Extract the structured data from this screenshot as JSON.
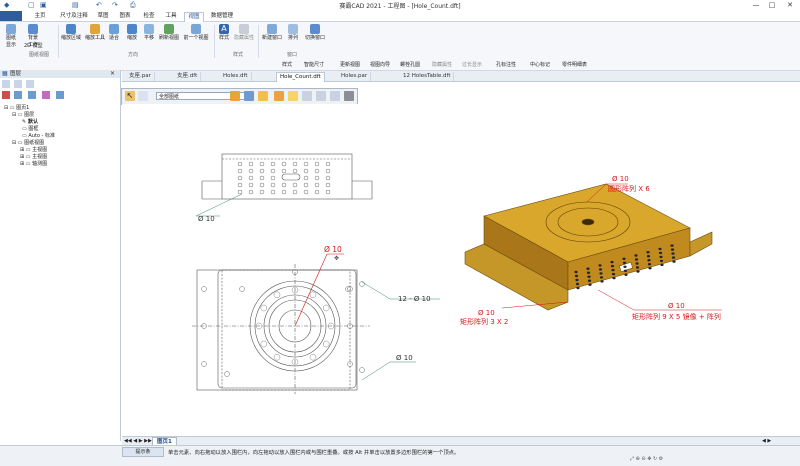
{
  "window": {
    "title": "赛霸CAD 2021 - 工程图 - [Hole_Count.dft]",
    "min_glyph": "—",
    "max_glyph": "□",
    "close_glyph": "✕"
  },
  "menu": {
    "app_button": "",
    "tabs": [
      "主页",
      "尺寸及注释",
      "草图",
      "图表",
      "检查",
      "工具",
      "视图",
      "数据管理"
    ],
    "active_tab": "视图"
  },
  "ribbon": {
    "buttons": [
      "图纸\n显示",
      "背景\n工作",
      "2D 模型",
      "缩放区域",
      "缩放工具",
      "适合",
      "缩放",
      "平移",
      "刷新视图",
      "前一个视图",
      "样式",
      "隐藏属性",
      "新建窗口",
      "排列",
      "切换窗口"
    ],
    "groups": [
      "图纸视图",
      "方向",
      "样式",
      "窗口"
    ]
  },
  "toolbar2": [
    "样式",
    "智能尺寸",
    "更新视图",
    "视图向导",
    "螺栓孔圆",
    "隐藏属性",
    "过长显示",
    "孔标注性",
    "中心标记",
    "零件明细表"
  ],
  "doc_tabs": [
    "支座.par",
    "支座.dft",
    "Holes.dft",
    "Hole_Count.dft",
    "Holes.par",
    "12 HolesTable.dft"
  ],
  "active_doc": "Hole_Count.dft",
  "left_panel": {
    "title": "图层",
    "tree": [
      "图页1",
      "图层",
      "默认",
      "图框",
      "Auto - 标准",
      "图纸视图",
      "主视图",
      "主视图",
      "轴测图"
    ]
  },
  "draw_toolbar": {
    "select_value": "全部图纸"
  },
  "annotations": {
    "top_view_hole": "Ø 10",
    "front_center": "Ø 10",
    "front_right_count": "12 - Ø 10",
    "front_bottom": "Ø 10",
    "iso_top_line1": "Ø 10",
    "iso_top_line2": "圆形阵列 X 6",
    "iso_left_line1": "Ø 10",
    "iso_left_line2": "矩形阵列 3 X 2",
    "iso_right_line1": "Ø 10",
    "iso_right_line2": "矩形阵列 9 X 5 镜像 + 阵列"
  },
  "sheet_tab": "图页1",
  "status": {
    "hint_label": "提示条",
    "hint_text": "单击元素、向右拖动以放入围栏内，向左拖动以放入围栏内或与围栏重叠。或按 Alt 并单击以放置多边形围栏的第一个顶点。"
  },
  "colors": {
    "accent": "#2f5d9c",
    "model": "#c8961e",
    "annotation": "#d21818"
  }
}
